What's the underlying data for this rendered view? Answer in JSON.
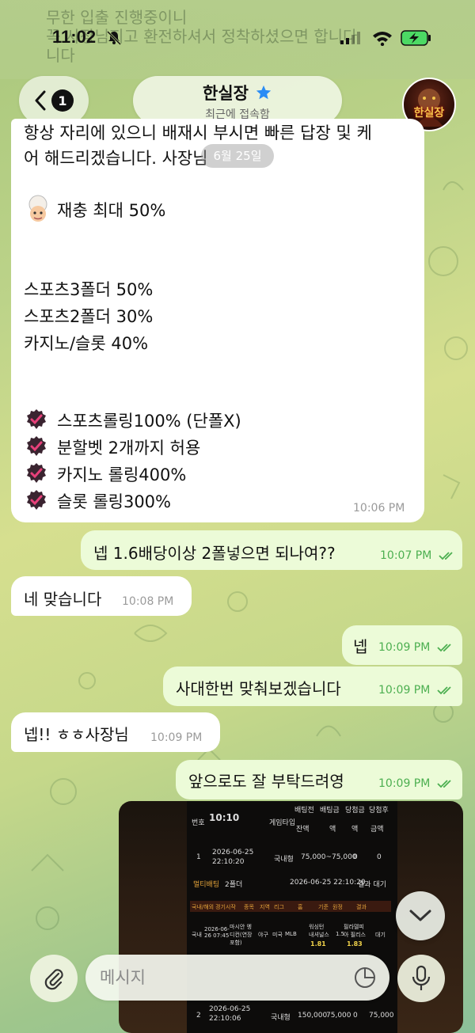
{
  "status_bar": {
    "time": "11:02"
  },
  "background_text": {
    "line1": "무한 입출 진행중이니",
    "line2": "꼭 사장님지고 환전하셔서 정착하셨으면 합니다",
    "line3": "니다"
  },
  "header": {
    "back_count": "1",
    "title": "한실장",
    "subtitle": "최근에 접속함",
    "avatar_label": "한실장"
  },
  "date_chip": "6월 25일",
  "big_message": {
    "line_top1": "항상 자리에 있으니 배재시 부시면 빠른 답장 및 케",
    "line_top2": "어 해드리겠습니다. 사장님",
    "recharge": "재충 최대 50%",
    "sports3": "스포츠3폴더 50%",
    "sports2": "스포츠2폴더 30%",
    "casino_slot": "카지노/슬롯 40%",
    "rules": [
      "스포츠롤링100% (단폴X)",
      "분할벳 2개까지 허용",
      "카지노 롤링400%",
      "슬롯 롤링300%"
    ],
    "time": "10:06 PM"
  },
  "messages": [
    {
      "direction": "out",
      "text": "넵 1.6배당이상 2폴넣으면 되나여??",
      "time": "10:07 PM"
    },
    {
      "direction": "in",
      "text": "네 맞습니다",
      "time": "10:08 PM"
    },
    {
      "direction": "out",
      "text": "넵",
      "time": "10:09 PM"
    },
    {
      "direction": "out",
      "text": "사대한번 맞춰보겠습니다",
      "time": "10:09 PM"
    },
    {
      "direction": "in",
      "text": "넵!! ㅎㅎ사장님",
      "time": "10:09 PM"
    },
    {
      "direction": "out",
      "text": "앞으로도 잘 부탁드려영",
      "time": "10:09 PM"
    }
  ],
  "photo": {
    "time": "10:10",
    "header_cols": [
      "번호",
      "게임타입",
      "배팅전",
      "배팅금",
      "당첨금",
      "당첨후"
    ],
    "sub_cols": [
      "잔액",
      "액",
      "액",
      "금액"
    ],
    "row1": {
      "no": "1",
      "date": "2026-06-25",
      "clock": "22:10:20",
      "type": "국내형",
      "amount": "75,000~75,000",
      "v1": "0",
      "v2": "0"
    },
    "multi_label": "멀티배팅",
    "folder": "2폴더",
    "multi_date": "2026-06-25 22:10:20",
    "result": "결과 대기",
    "table_cols": [
      "국내/해외",
      "경기시작",
      "종목",
      "지역",
      "리그",
      "홈",
      "기준",
      "원정",
      "결과"
    ],
    "table_row": {
      "kind": "국내",
      "start": "2026-06-26 07:45",
      "game": "마시안 엥디컨(연장포함)",
      "sport": "야구",
      "region": "미국",
      "league": "MLB",
      "home": "워싱턴 내셔널스",
      "home_odds": "1.81",
      "base": "1.5",
      "away": "필라델피아 필리스",
      "away_odds": "1.83",
      "status": "대기"
    },
    "row2": {
      "no": "2",
      "date": "2026-06-25",
      "clock": "22:10:06",
      "type": "국내형",
      "amount": "150,000",
      "v1": "75,000",
      "v2": "0",
      "v3": "75,000"
    }
  },
  "input": {
    "placeholder": "메시지"
  },
  "colors": {
    "outgoing_bubble": "#ecfbd8",
    "incoming_bubble": "#ffffff",
    "check_green": "#4caf50",
    "star_blue": "#2a8cf5",
    "badge_dark": "#3a2430"
  }
}
